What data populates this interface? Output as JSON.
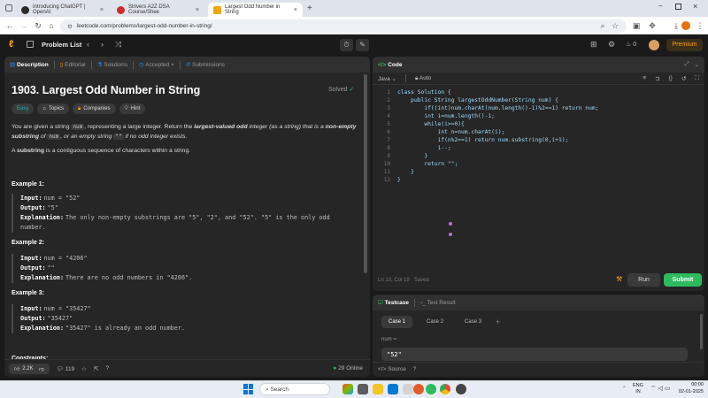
{
  "browser": {
    "tabs": [
      {
        "title": "Introducing ChatGPT | OpenAI",
        "color": "#2b2b2b"
      },
      {
        "title": "Strivers A2Z DSA Course/Shee",
        "color": "#c9302c"
      },
      {
        "title": "Largest Odd Number in String",
        "color": "#f0a500"
      }
    ],
    "url": "leetcode.com/problems/largest-odd-number-in-string/"
  },
  "lcnav": {
    "problem_list": "Problem List",
    "streak": "0",
    "premium": "Premium"
  },
  "left": {
    "tabs": [
      "Description",
      "Editorial",
      "Solutions",
      "Accepted",
      "Submissions"
    ],
    "title": "1903. Largest Odd Number in String",
    "solved": "Solved",
    "difficulty": "Easy",
    "chips": [
      "Topics",
      "Companies",
      "Hint"
    ],
    "desc1_a": "You are given a string ",
    "desc1_code": "num",
    "desc1_b": ", representing a large integer. Return the ",
    "desc1_strong": "largest-valued odd",
    "desc1_c": " integer (as a string) that is a ",
    "desc1_strong2": "non-empty substring",
    "desc1_d": " of ",
    "desc1_code2": "num",
    "desc1_e": ", or an empty string ",
    "desc1_code3": "\"\"",
    "desc1_f": " if no odd integer exists.",
    "desc2_a": "A ",
    "desc2_strong": "substring",
    "desc2_b": " is a contiguous sequence of characters within a string.",
    "examples": [
      {
        "title": "Example 1:",
        "input": "num = \"52\"",
        "output": "\"5\"",
        "explanation": "The only non-empty substrings are \"5\", \"2\", and \"52\". \"5\" is the only odd",
        "explanation2": "number."
      },
      {
        "title": "Example 2:",
        "input": "num = \"4206\"",
        "output": "\"\"",
        "explanation": "There are no odd numbers in \"4206\".",
        "explanation2": ""
      },
      {
        "title": "Example 3:",
        "input": "num = \"35427\"",
        "output": "\"35427\"",
        "explanation": "\"35427\" is already an odd number.",
        "explanation2": ""
      }
    ],
    "labels": {
      "input": "Input:",
      "output": "Output:",
      "explanation": "Explanation:"
    },
    "constraints_partial": "Constraints:",
    "likes": "2.2K",
    "comments": "119",
    "online": "29 Online"
  },
  "code": {
    "tab": "Code",
    "language": "Java",
    "auto": "Auto",
    "lines": [
      "class Solution {",
      "    public String largestOddNumber(String num) {",
      "        if((int)num.charAt(num.length()-1)%2==1) return num;",
      "        int i=num.length()-1;",
      "        while(i>=0){",
      "            int n=num.charAt(i);",
      "            if(n%2==1) return num.substring(0,i+1);",
      "            i--;",
      "        }",
      "        return \"\";",
      "    }",
      "}"
    ],
    "status": "Ln 10, Col 19",
    "saved": "Saved",
    "run": "Run",
    "submit": "Submit"
  },
  "tests": {
    "tab1": "Testcase",
    "tab2": "Test Result",
    "cases": [
      "Case 1",
      "Case 2",
      "Case 3"
    ],
    "var_label": "num =",
    "var_value": "\"52\"",
    "source": "Source"
  },
  "taskbar": {
    "search": "Search",
    "lang": "ENG",
    "region": "IN",
    "time": "00:00",
    "date": "02-01-2025"
  },
  "colors": {
    "accent_green": "#2cbb5d",
    "easy": "#1cb8b8",
    "premium": "#ffa116"
  }
}
